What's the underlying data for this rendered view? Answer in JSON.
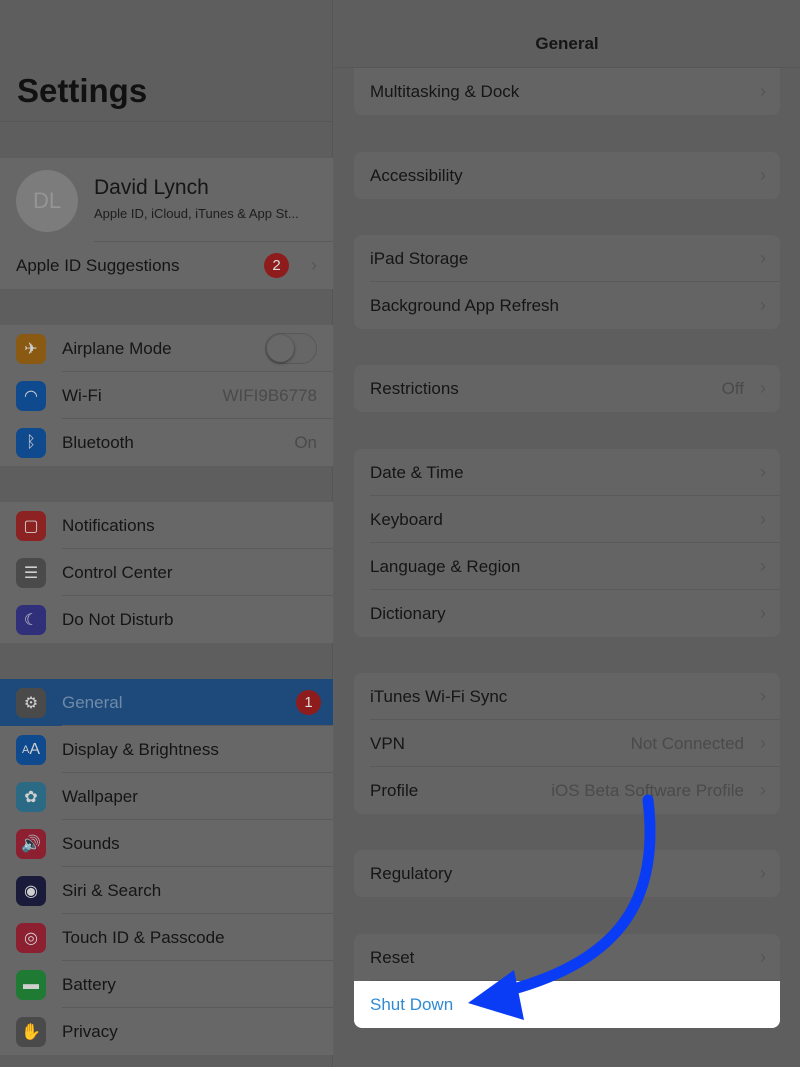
{
  "left_pane": {
    "title": "Settings",
    "profile": {
      "initials": "DL",
      "name": "David Lynch",
      "subtitle": "Apple ID, iCloud, iTunes & App St..."
    },
    "apple_id_suggestions": {
      "label": "Apple ID Suggestions",
      "badge": "2"
    },
    "groups": [
      [
        {
          "id": "airplane-mode",
          "label": "Airplane Mode",
          "icon": "airplane-icon",
          "icon_color": "#8a5a12",
          "toggle": false
        },
        {
          "id": "wifi",
          "label": "Wi-Fi",
          "icon": "wifi-icon",
          "icon_color": "#0f4a8e",
          "value": "WIFI9B6778"
        },
        {
          "id": "bluetooth",
          "label": "Bluetooth",
          "icon": "bluetooth-icon",
          "icon_color": "#0f4a8e",
          "value": "On"
        }
      ],
      [
        {
          "id": "notifications",
          "label": "Notifications",
          "icon": "notifications-icon",
          "icon_color": "#8c2222"
        },
        {
          "id": "control-center",
          "label": "Control Center",
          "icon": "control-center-icon",
          "icon_color": "#4a4a4a"
        },
        {
          "id": "do-not-disturb",
          "label": "Do Not Disturb",
          "icon": "moon-icon",
          "icon_color": "#2f2f7a"
        }
      ],
      [
        {
          "id": "general",
          "label": "General",
          "icon": "gear-icon",
          "icon_color": "#4a4a4a",
          "badge": "1",
          "selected": true
        },
        {
          "id": "display-brightness",
          "label": "Display & Brightness",
          "icon": "text-size-icon",
          "icon_color": "#0f4a8e"
        },
        {
          "id": "wallpaper",
          "label": "Wallpaper",
          "icon": "flower-icon",
          "icon_color": "#2a6a85"
        },
        {
          "id": "sounds",
          "label": "Sounds",
          "icon": "speaker-icon",
          "icon_color": "#8c1f30"
        },
        {
          "id": "siri-search",
          "label": "Siri & Search",
          "icon": "siri-icon",
          "icon_color": "#1a1a3a"
        },
        {
          "id": "touch-id-passcode",
          "label": "Touch ID & Passcode",
          "icon": "fingerprint-icon",
          "icon_color": "#8c1f30"
        },
        {
          "id": "battery",
          "label": "Battery",
          "icon": "battery-icon",
          "icon_color": "#1f7a33"
        },
        {
          "id": "privacy",
          "label": "Privacy",
          "icon": "hand-icon",
          "icon_color": "#4a4a4a"
        }
      ]
    ]
  },
  "right_pane": {
    "title": "General",
    "cards": [
      [
        {
          "id": "multitasking-dock",
          "label": "Multitasking & Dock"
        }
      ],
      [
        {
          "id": "accessibility",
          "label": "Accessibility"
        }
      ],
      [
        {
          "id": "ipad-storage",
          "label": "iPad Storage"
        },
        {
          "id": "background-app-refresh",
          "label": "Background App Refresh"
        }
      ],
      [
        {
          "id": "restrictions",
          "label": "Restrictions",
          "value": "Off"
        }
      ],
      [
        {
          "id": "date-time",
          "label": "Date & Time"
        },
        {
          "id": "keyboard",
          "label": "Keyboard"
        },
        {
          "id": "language-region",
          "label": "Language & Region"
        },
        {
          "id": "dictionary",
          "label": "Dictionary"
        }
      ],
      [
        {
          "id": "itunes-wifi-sync",
          "label": "iTunes Wi-Fi Sync"
        },
        {
          "id": "vpn",
          "label": "VPN",
          "value": "Not Connected"
        },
        {
          "id": "profile",
          "label": "Profile",
          "value": "iOS Beta Software Profile"
        }
      ],
      [
        {
          "id": "regulatory",
          "label": "Regulatory"
        }
      ],
      [
        {
          "id": "reset",
          "label": "Reset"
        },
        {
          "id": "shut-down",
          "label": "Shut Down",
          "highlight": true,
          "no_chevron": true
        }
      ]
    ]
  },
  "annotation": {
    "arrow_color": "#0b3cf5",
    "target": "Shut Down"
  },
  "colors": {
    "highlight_text": "#2f8ad4",
    "selected_row": "#1e4a7b",
    "badge": "#8e1c1c"
  }
}
